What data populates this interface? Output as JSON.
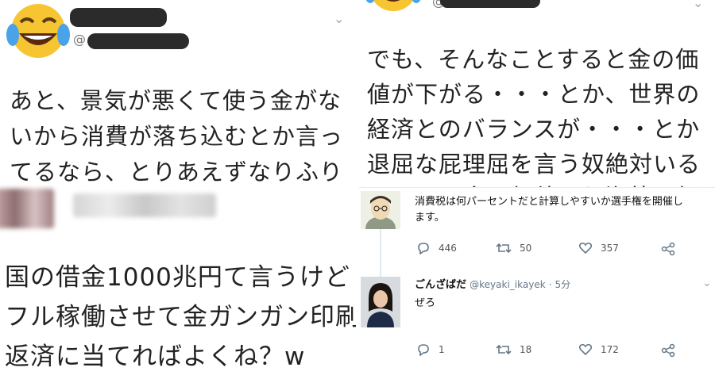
{
  "top_left": {
    "handle_prefix": "@",
    "lines": [
      "あと、景気が悪くて使う金がな",
      "いから消費が落ち込むとか言っ",
      "てるなら、とりあえずなりふり"
    ]
  },
  "top_right": {
    "handle_prefix": "@",
    "lines": [
      "でも、そんなことすると金の価",
      "値が下がる・・・とか、世界の",
      "経済とのバランスが・・・とか",
      "退屈な屁理屈を言う奴絶対いる",
      "でしょ。金の価値より海外の経"
    ]
  },
  "bottom_left": {
    "lines": [
      "国の借金1000兆円て言うけど",
      "フル稼働させて金ガンガン印刷",
      "返済に当てればよくね？w"
    ]
  },
  "tweet1": {
    "text_line1": "消費税は何パーセントだと計算しやすいか選手権を開催し",
    "text_line2": "ます。",
    "replies": "446",
    "retweets": "50",
    "likes": "357"
  },
  "tweet2": {
    "name": "ごんざばだ",
    "handle": "@keyaki_ikayek",
    "time": "· 5分",
    "text": "ぜろ",
    "replies": "1",
    "retweets": "18",
    "likes": "172"
  },
  "colors": {
    "redaction": "#2b2b2b",
    "icon_gray": "#657786"
  }
}
